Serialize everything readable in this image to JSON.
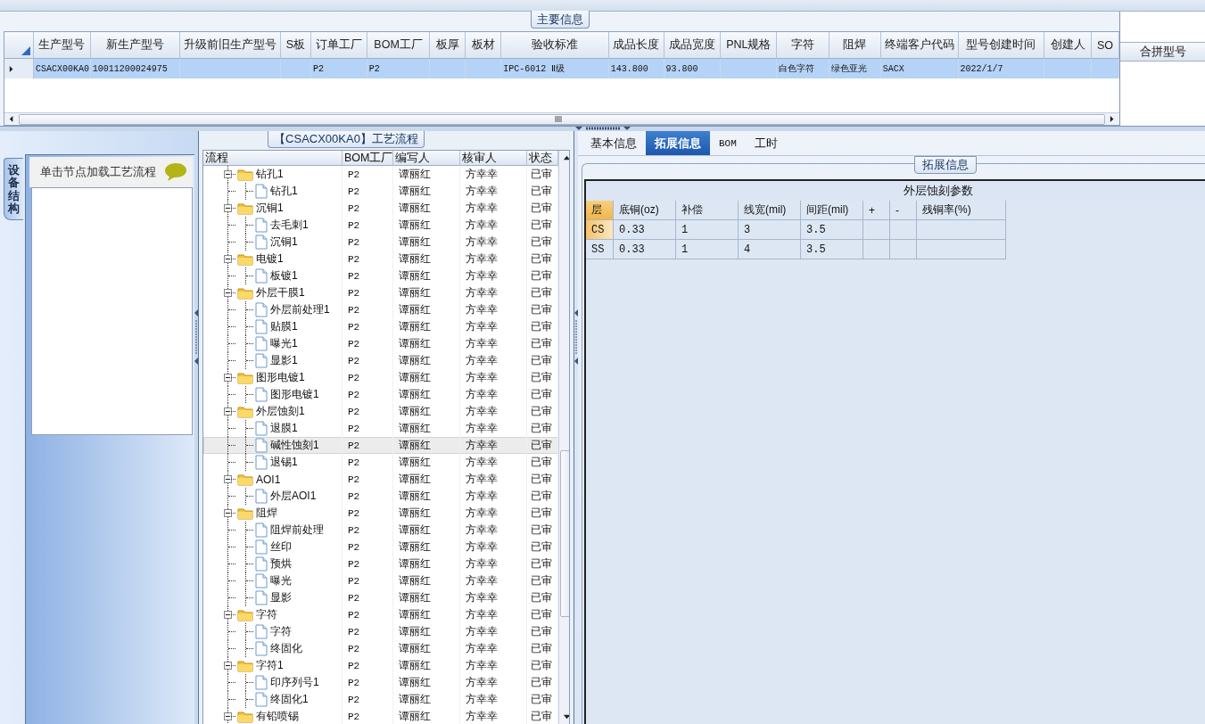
{
  "main_info": {
    "title": "主要信息",
    "columns": [
      "生产型号",
      "新生产型号",
      "升级前旧生产型号",
      "S板",
      "订单工厂",
      "BOM工厂",
      "板厚",
      "板材",
      "验收标准",
      "成品长度",
      "成品宽度",
      "PNL规格",
      "字符",
      "阻焊",
      "终端客户代码",
      "型号创建时间",
      "创建人",
      "SO"
    ],
    "rows": [
      {
        "selected": true,
        "cells": [
          "CSACX00KA0",
          "10011200024975",
          null,
          null,
          "P2",
          "P2",
          null,
          null,
          "IPC-6012 Ⅱ级",
          "143.800",
          "93.800",
          null,
          "白色字符",
          "绿色亚光",
          "SACX",
          "2022/1/7",
          null,
          null
        ]
      }
    ]
  },
  "merge_panel": {
    "title": "合拼型号"
  },
  "side_panel": {
    "tab": "设备结构",
    "header": "单击节点加载工艺流程"
  },
  "process": {
    "title": "【CSACX00KA0】工艺流程",
    "columns": [
      "流程",
      "BOM工厂",
      "编写人",
      "核审人",
      "状态"
    ],
    "nodes": [
      {
        "name": "钻孔1",
        "factory": "P2",
        "writer": "谭丽红",
        "reviewer": "方幸幸",
        "status": "已审",
        "selected": false,
        "expanded": true,
        "children": [
          {
            "name": "钻孔1",
            "factory": "P2",
            "writer": "谭丽红",
            "reviewer": "方幸幸",
            "status": "已审",
            "selected": false
          }
        ]
      },
      {
        "name": "沉铜1",
        "factory": "P2",
        "writer": "谭丽红",
        "reviewer": "方幸幸",
        "status": "已审",
        "selected": false,
        "expanded": true,
        "children": [
          {
            "name": "去毛刺1",
            "factory": "P2",
            "writer": "谭丽红",
            "reviewer": "方幸幸",
            "status": "已审",
            "selected": false
          },
          {
            "name": "沉铜1",
            "factory": "P2",
            "writer": "谭丽红",
            "reviewer": "方幸幸",
            "status": "已审",
            "selected": false
          }
        ]
      },
      {
        "name": "电镀1",
        "factory": "P2",
        "writer": "谭丽红",
        "reviewer": "方幸幸",
        "status": "已审",
        "selected": false,
        "expanded": true,
        "children": [
          {
            "name": "板镀1",
            "factory": "P2",
            "writer": "谭丽红",
            "reviewer": "方幸幸",
            "status": "已审",
            "selected": false
          }
        ]
      },
      {
        "name": "外层干膜1",
        "factory": "P2",
        "writer": "谭丽红",
        "reviewer": "方幸幸",
        "status": "已审",
        "selected": false,
        "expanded": true,
        "children": [
          {
            "name": "外层前处理1",
            "factory": "P2",
            "writer": "谭丽红",
            "reviewer": "方幸幸",
            "status": "已审",
            "selected": false
          },
          {
            "name": "贴膜1",
            "factory": "P2",
            "writer": "谭丽红",
            "reviewer": "方幸幸",
            "status": "已审",
            "selected": false
          },
          {
            "name": "曝光1",
            "factory": "P2",
            "writer": "谭丽红",
            "reviewer": "方幸幸",
            "status": "已审",
            "selected": false
          },
          {
            "name": "显影1",
            "factory": "P2",
            "writer": "谭丽红",
            "reviewer": "方幸幸",
            "status": "已审",
            "selected": false
          }
        ]
      },
      {
        "name": "图形电镀1",
        "factory": "P2",
        "writer": "谭丽红",
        "reviewer": "方幸幸",
        "status": "已审",
        "selected": false,
        "expanded": true,
        "children": [
          {
            "name": "图形电镀1",
            "factory": "P2",
            "writer": "谭丽红",
            "reviewer": "方幸幸",
            "status": "已审",
            "selected": false
          }
        ]
      },
      {
        "name": "外层蚀刻1",
        "factory": "P2",
        "writer": "谭丽红",
        "reviewer": "方幸幸",
        "status": "已审",
        "selected": false,
        "expanded": true,
        "children": [
          {
            "name": "退膜1",
            "factory": "P2",
            "writer": "谭丽红",
            "reviewer": "方幸幸",
            "status": "已审",
            "selected": false
          },
          {
            "name": "碱性蚀刻1",
            "factory": "P2",
            "writer": "谭丽红",
            "reviewer": "方幸幸",
            "status": "已审",
            "selected": true
          },
          {
            "name": "退锡1",
            "factory": "P2",
            "writer": "谭丽红",
            "reviewer": "方幸幸",
            "status": "已审",
            "selected": false
          }
        ]
      },
      {
        "name": "AOI1",
        "factory": "P2",
        "writer": "谭丽红",
        "reviewer": "方幸幸",
        "status": "已审",
        "selected": false,
        "expanded": true,
        "children": [
          {
            "name": "外层AOI1",
            "factory": "P2",
            "writer": "谭丽红",
            "reviewer": "方幸幸",
            "status": "已审",
            "selected": false
          }
        ]
      },
      {
        "name": "阻焊",
        "factory": "P2",
        "writer": "谭丽红",
        "reviewer": "方幸幸",
        "status": "已审",
        "selected": false,
        "expanded": true,
        "children": [
          {
            "name": "阻焊前处理",
            "factory": "P2",
            "writer": "谭丽红",
            "reviewer": "方幸幸",
            "status": "已审",
            "selected": false
          },
          {
            "name": "丝印",
            "factory": "P2",
            "writer": "谭丽红",
            "reviewer": "方幸幸",
            "status": "已审",
            "selected": false
          },
          {
            "name": "预烘",
            "factory": "P2",
            "writer": "谭丽红",
            "reviewer": "方幸幸",
            "status": "已审",
            "selected": false
          },
          {
            "name": "曝光",
            "factory": "P2",
            "writer": "谭丽红",
            "reviewer": "方幸幸",
            "status": "已审",
            "selected": false
          },
          {
            "name": "显影",
            "factory": "P2",
            "writer": "谭丽红",
            "reviewer": "方幸幸",
            "status": "已审",
            "selected": false
          }
        ]
      },
      {
        "name": "字符",
        "factory": "P2",
        "writer": "谭丽红",
        "reviewer": "方幸幸",
        "status": "已审",
        "selected": false,
        "expanded": true,
        "children": [
          {
            "name": "字符",
            "factory": "P2",
            "writer": "谭丽红",
            "reviewer": "方幸幸",
            "status": "已审",
            "selected": false
          },
          {
            "name": "终固化",
            "factory": "P2",
            "writer": "谭丽红",
            "reviewer": "方幸幸",
            "status": "已审",
            "selected": false
          }
        ]
      },
      {
        "name": "字符1",
        "factory": "P2",
        "writer": "谭丽红",
        "reviewer": "方幸幸",
        "status": "已审",
        "selected": false,
        "expanded": true,
        "children": [
          {
            "name": "印序列号1",
            "factory": "P2",
            "writer": "谭丽红",
            "reviewer": "方幸幸",
            "status": "已审",
            "selected": false
          },
          {
            "name": "终固化1",
            "factory": "P2",
            "writer": "谭丽红",
            "reviewer": "方幸幸",
            "status": "已审",
            "selected": false
          }
        ]
      },
      {
        "name": "有铅喷锡",
        "factory": "P2",
        "writer": "谭丽红",
        "reviewer": "方幸幸",
        "status": "已审",
        "selected": false,
        "expanded": true
      }
    ]
  },
  "detail": {
    "tabs": [
      {
        "label": "基本信息",
        "selected": false
      },
      {
        "label": "拓展信息",
        "selected": true
      },
      {
        "label": "BOM",
        "selected": false
      },
      {
        "label": "工时",
        "selected": false
      }
    ],
    "group_title": "拓展信息",
    "table": {
      "title": "外层蚀刻参数",
      "columns": [
        "层",
        "底铜(oz)",
        "补偿",
        "线宽(mil)",
        "间距(mil)",
        "+",
        "-",
        "残铜率(%)"
      ],
      "rows": [
        {
          "selected": true,
          "cells": [
            "CS",
            "0.33",
            "1",
            "3",
            "3.5",
            null,
            null,
            null
          ]
        },
        {
          "selected": false,
          "cells": [
            "SS",
            "0.33",
            "1",
            "4",
            "3.5",
            null,
            null,
            null
          ]
        }
      ]
    }
  }
}
